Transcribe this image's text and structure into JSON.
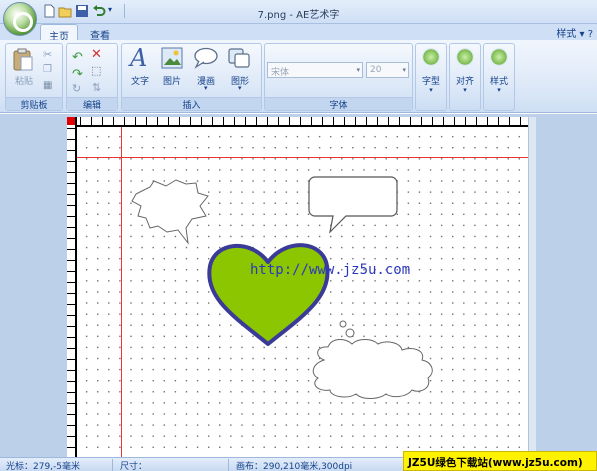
{
  "window": {
    "title": "7.png - AE艺术字",
    "right_menu": "样式 ▾ ?"
  },
  "tabs": [
    {
      "label": "主页",
      "active": true
    },
    {
      "label": "查看",
      "active": false
    }
  ],
  "groups": {
    "clipboard": {
      "label": "剪贴板",
      "paste": "粘贴"
    },
    "edit": {
      "label": "编辑"
    },
    "insert": {
      "label": "插入",
      "text": "文字",
      "image": "图片",
      "comic": "漫画",
      "shape": "图形"
    },
    "font": {
      "label": "字体",
      "family_placeholder": "宋体",
      "size_placeholder": "20"
    },
    "glyph": {
      "label": "字型"
    },
    "align": {
      "label": "对齐"
    },
    "style": {
      "label": "样式"
    }
  },
  "canvas": {
    "url_text": "http://www.jz5u.com"
  },
  "status": {
    "cursor": "光标：279,-5毫米",
    "size": "尺寸：",
    "canvas": "画布：290,210毫米,300dpi"
  },
  "watermark": "JZ5U绿色下载站(www.jz5u.com)"
}
